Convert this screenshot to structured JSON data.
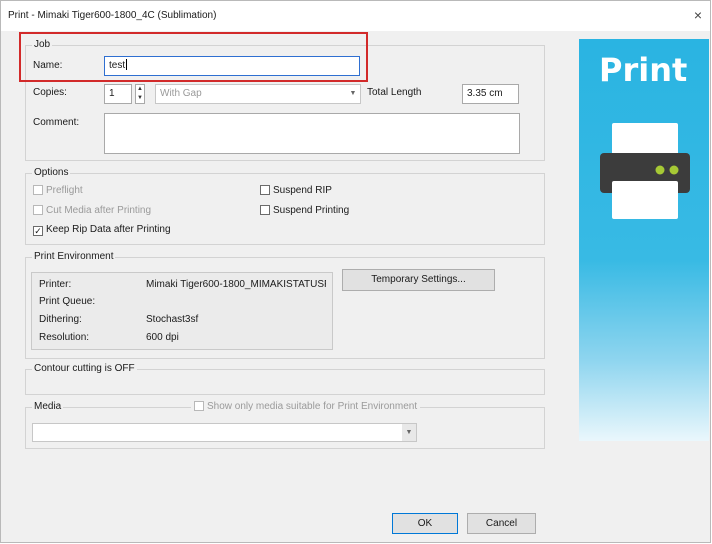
{
  "window": {
    "title": "Print - Mimaki Tiger600-1800_4C (Sublimation)",
    "close_glyph": "×"
  },
  "job": {
    "group_label": "Job",
    "name_label": "Name:",
    "name_value": "test",
    "copies_label": "Copies:",
    "copies_value": "1",
    "gap_select": "With Gap",
    "total_length_label": "Total Length",
    "total_length_value": "3.35 cm",
    "comment_label": "Comment:",
    "comment_value": ""
  },
  "options": {
    "group_label": "Options",
    "preflight": {
      "label": "Preflight",
      "checked": false,
      "enabled": false
    },
    "cut_media": {
      "label": "Cut Media after Printing",
      "checked": false,
      "enabled": false
    },
    "keep_rip": {
      "label": "Keep Rip Data after Printing",
      "checked": true,
      "enabled": true
    },
    "suspend_rip": {
      "label": "Suspend RIP",
      "checked": false,
      "enabled": true
    },
    "suspend_printing": {
      "label": "Suspend Printing",
      "checked": false,
      "enabled": true
    }
  },
  "environment": {
    "group_label": "Print Environment",
    "printer_label": "Printer:",
    "printer_value": "Mimaki Tiger600-1800_MIMAKISTATUSPC",
    "queue_label": "Print Queue:",
    "queue_value": "",
    "dithering_label": "Dithering:",
    "dithering_value": "Stochast3sf",
    "resolution_label": "Resolution:",
    "resolution_value": "600 dpi",
    "temp_settings_button": "Temporary Settings..."
  },
  "contour": {
    "group_label": "Contour cutting is OFF"
  },
  "media": {
    "group_label": "Media",
    "suitable_only_label": "Show only media suitable for Print Environment",
    "suitable_only_checked": false,
    "selected": ""
  },
  "buttons": {
    "ok": "OK",
    "cancel": "Cancel"
  },
  "banner": {
    "text": "Print",
    "icon": "printer-icon"
  },
  "colors": {
    "highlight": "#d22a2a",
    "banner": "#2ab4e2",
    "printer_light": "#a6c935"
  }
}
